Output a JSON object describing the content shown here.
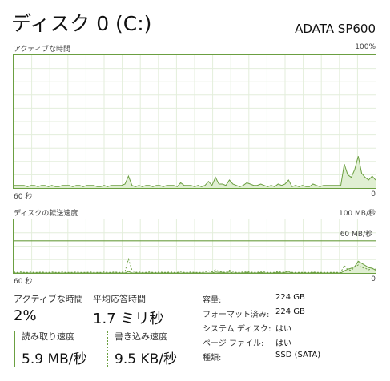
{
  "header": {
    "title": "ディスク 0 (C:)",
    "model": "ADATA SP600"
  },
  "active_time_graph": {
    "label": "アクティブな時間",
    "max_label": "100%",
    "time_label": "60 秒",
    "min_label": "0",
    "values_percent": [
      2,
      2,
      2,
      2,
      1,
      2,
      2,
      1,
      2,
      2,
      1,
      2,
      1,
      1,
      2,
      2,
      2,
      1,
      2,
      2,
      1,
      2,
      2,
      2,
      1,
      1,
      2,
      1,
      2,
      2,
      2,
      2,
      3,
      9,
      2,
      1,
      2,
      1,
      2,
      2,
      1,
      2,
      2,
      1,
      2,
      2,
      2,
      1,
      4,
      2,
      2,
      2,
      1,
      2,
      1,
      2,
      5,
      2,
      8,
      3,
      3,
      2,
      6,
      3,
      2,
      1,
      2,
      4,
      3,
      2,
      2,
      3,
      2,
      1,
      2,
      1,
      3,
      2,
      3,
      6,
      1,
      2,
      1,
      2,
      1,
      1,
      3,
      2,
      1,
      2,
      2,
      2,
      2,
      2,
      2,
      18,
      10,
      8,
      14,
      24,
      11,
      8,
      6,
      9,
      6
    ],
    "color": "#6b9f41",
    "fill": "#e0efd2"
  },
  "transfer_graph": {
    "label": "ディスクの転送速度",
    "max_label": "100 MB/秒",
    "line_label": "60 MB/秒",
    "line_value_mbps": 60,
    "time_label": "60 秒",
    "min_label": "0",
    "read_mbps": [
      0,
      0,
      0,
      0,
      0,
      0,
      0,
      0,
      0,
      0,
      0,
      0,
      0,
      0,
      0,
      0,
      0,
      0,
      0,
      0,
      0,
      0,
      0,
      0,
      0,
      0,
      0,
      0,
      0,
      0,
      0,
      0,
      0,
      3,
      0,
      0,
      0,
      0,
      0,
      0,
      0,
      0,
      0,
      0,
      0,
      0,
      0,
      0,
      0,
      0,
      0,
      0,
      0,
      0,
      0,
      0,
      0,
      0,
      2,
      1,
      1,
      0,
      2,
      0,
      0,
      0,
      0,
      1,
      0,
      0,
      0,
      1,
      0,
      0,
      0,
      0,
      1,
      0,
      1,
      2,
      0,
      0,
      0,
      0,
      0,
      0,
      1,
      0,
      0,
      0,
      0,
      0,
      0,
      0,
      0,
      4,
      7,
      9,
      12,
      22,
      18,
      14,
      10,
      9,
      5
    ],
    "write_mbps": [
      2,
      1,
      2,
      1,
      1,
      2,
      1,
      1,
      2,
      1,
      1,
      2,
      1,
      1,
      2,
      1,
      1,
      1,
      2,
      1,
      1,
      1,
      2,
      1,
      1,
      1,
      2,
      1,
      1,
      2,
      1,
      1,
      3,
      26,
      5,
      1,
      2,
      1,
      1,
      2,
      1,
      1,
      2,
      1,
      1,
      2,
      1,
      1,
      3,
      1,
      1,
      2,
      1,
      1,
      1,
      2,
      4,
      2,
      6,
      3,
      2,
      1,
      5,
      3,
      1,
      1,
      2,
      3,
      2,
      1,
      1,
      3,
      2,
      1,
      1,
      1,
      3,
      1,
      2,
      4,
      1,
      1,
      1,
      1,
      1,
      1,
      2,
      1,
      1,
      1,
      1,
      1,
      1,
      1,
      1,
      14,
      6,
      5,
      11,
      15,
      10,
      9,
      6,
      8,
      7
    ],
    "color": "#6b9f41",
    "fill": "#e0efd2"
  },
  "stats": {
    "active_time_label": "アクティブな時間",
    "active_time_value": "2%",
    "avg_response_label": "平均応答時間",
    "avg_response_value": "1.7 ミリ秒",
    "read_label": "読み取り速度",
    "read_value": "5.9 MB/秒",
    "write_label": "書き込み速度",
    "write_value": "9.5 KB/秒"
  },
  "properties": [
    {
      "label": "容量:",
      "value": "224 GB"
    },
    {
      "label": "フォーマット済み:",
      "value": "224 GB"
    },
    {
      "label": "システム ディスク:",
      "value": "はい"
    },
    {
      "label": "ページ ファイル:",
      "value": "はい"
    },
    {
      "label": "種類:",
      "value": "SSD (SATA)"
    }
  ]
}
